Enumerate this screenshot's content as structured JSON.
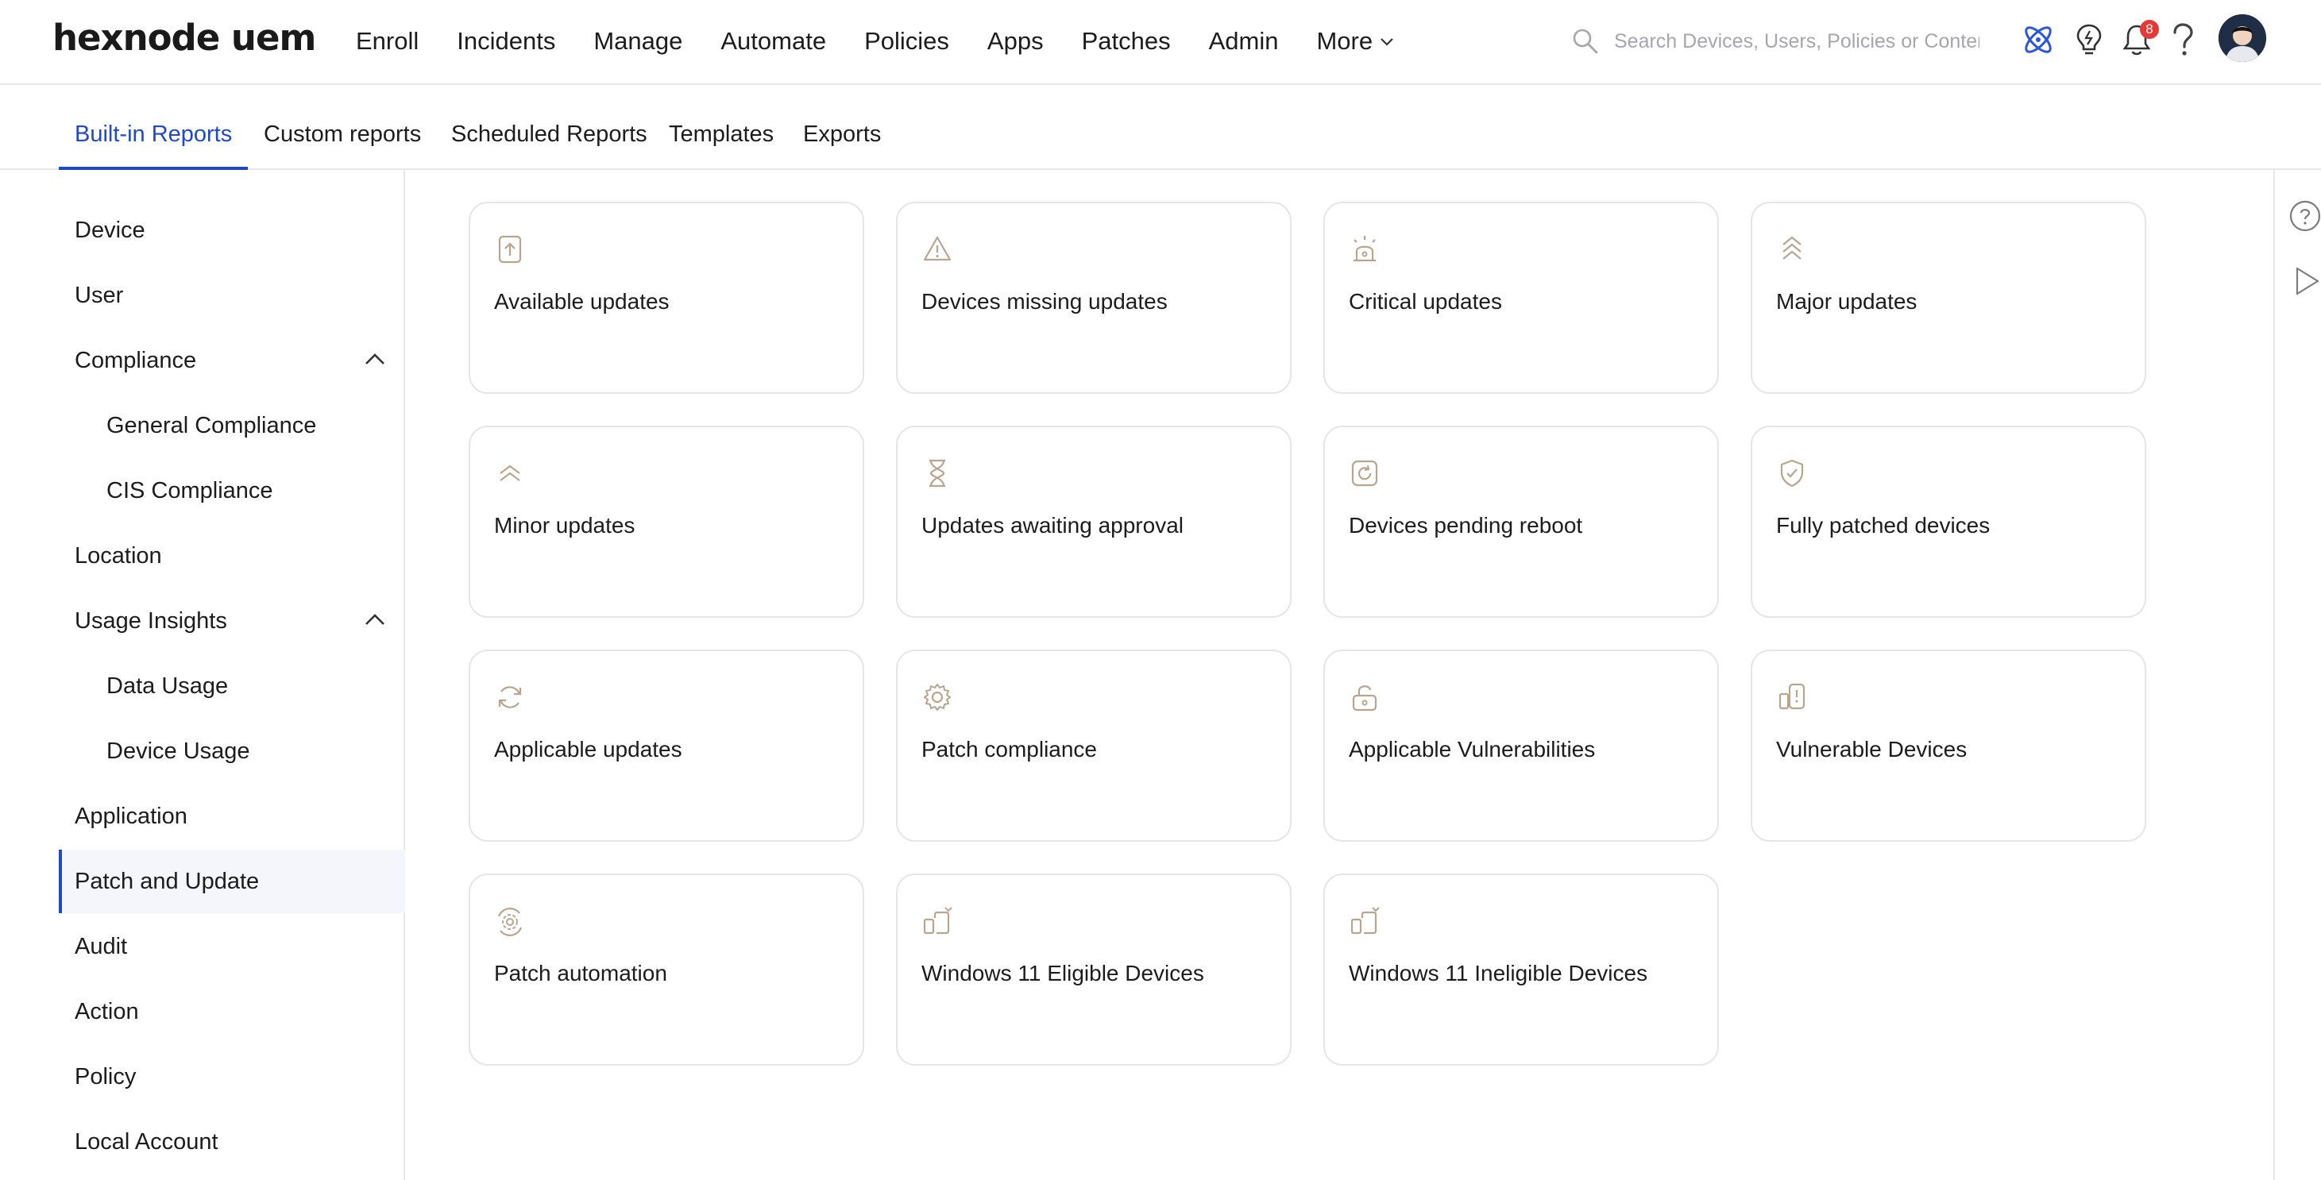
{
  "brand": {
    "logo_text": "hexnode uem"
  },
  "nav": {
    "items": [
      "Enroll",
      "Incidents",
      "Manage",
      "Automate",
      "Policies",
      "Apps",
      "Patches",
      "Admin"
    ],
    "more_label": "More"
  },
  "search": {
    "placeholder": "Search Devices, Users, Policies or Content"
  },
  "notifications": {
    "count": "8"
  },
  "tabs": {
    "items": [
      "Built-in Reports",
      "Custom reports",
      "Scheduled Reports",
      "Templates",
      "Exports"
    ],
    "active": "Built-in Reports"
  },
  "sidebar": {
    "items": [
      {
        "label": "Device"
      },
      {
        "label": "User"
      },
      {
        "label": "Compliance"
      },
      {
        "label": "General Compliance"
      },
      {
        "label": "CIS Compliance"
      },
      {
        "label": "Location"
      },
      {
        "label": "Usage Insights"
      },
      {
        "label": "Data Usage"
      },
      {
        "label": "Device Usage"
      },
      {
        "label": "Application"
      },
      {
        "label": "Patch and Update"
      },
      {
        "label": "Audit"
      },
      {
        "label": "Action"
      },
      {
        "label": "Policy"
      },
      {
        "label": "Local Account"
      }
    ],
    "active": "Patch and Update"
  },
  "reports": [
    {
      "title": "Available updates",
      "icon": "upload-arrow-icon"
    },
    {
      "title": "Devices missing updates",
      "icon": "warning-triangle-icon"
    },
    {
      "title": "Critical updates",
      "icon": "siren-icon"
    },
    {
      "title": "Major updates",
      "icon": "triple-chevron-up-icon"
    },
    {
      "title": "Minor updates",
      "icon": "double-chevron-up-icon"
    },
    {
      "title": "Updates awaiting approval",
      "icon": "hourglass-icon"
    },
    {
      "title": "Devices pending reboot",
      "icon": "reboot-icon"
    },
    {
      "title": "Fully patched devices",
      "icon": "shield-check-icon"
    },
    {
      "title": "Applicable updates",
      "icon": "refresh-icon"
    },
    {
      "title": "Patch compliance",
      "icon": "gear-icon"
    },
    {
      "title": "Applicable Vulnerabilities",
      "icon": "unlocked-padlock-icon"
    },
    {
      "title": "Vulnerable Devices",
      "icon": "device-alert-icon"
    },
    {
      "title": "Patch automation",
      "icon": "auto-gear-icon"
    },
    {
      "title": "Windows 11 Eligible Devices",
      "icon": "device-sync-icon"
    },
    {
      "title": "Windows 11 Ineligible Devices",
      "icon": "device-sync-icon"
    }
  ],
  "colors": {
    "accent": "#1f49c6",
    "icon": "#b9a58e",
    "border": "#e6e6ea",
    "badge": "#e53935"
  }
}
